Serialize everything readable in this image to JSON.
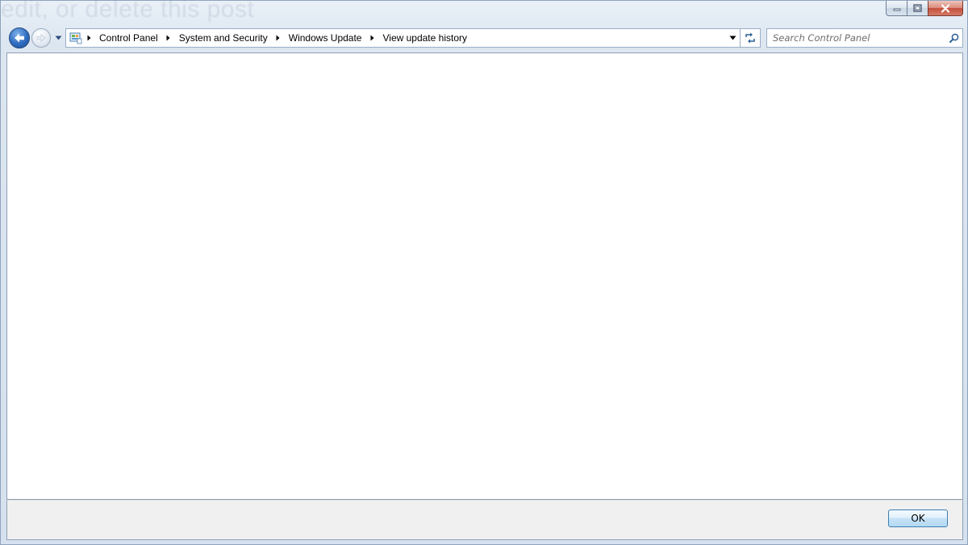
{
  "background": {
    "ghost_text": "edit, or delete this post"
  },
  "window": {
    "caption_buttons": {
      "minimize_icon": "minimize-icon",
      "maximize_icon": "restore-icon",
      "close_icon": "close-icon"
    }
  },
  "navigation": {
    "back_icon": "back-arrow-icon",
    "forward_icon": "forward-arrow-icon",
    "recent_icon": "chevron-down-icon"
  },
  "address_bar": {
    "root_icon": "control-panel-icon",
    "breadcrumbs": [
      {
        "label": "Control Panel"
      },
      {
        "label": "System and Security"
      },
      {
        "label": "Windows Update"
      },
      {
        "label": "View update history"
      }
    ],
    "dropdown_icon": "chevron-down-icon",
    "refresh_icon": "refresh-icon"
  },
  "search": {
    "placeholder": "Search Control Panel",
    "value": "",
    "icon": "search-icon"
  },
  "footer": {
    "ok_label": "OK"
  },
  "colors": {
    "frame": "#dce6f1",
    "content": "#ffffff",
    "footer": "#f0f0f0",
    "close_button": "#c44f3b",
    "ok_button_border": "#3c7fb1"
  }
}
